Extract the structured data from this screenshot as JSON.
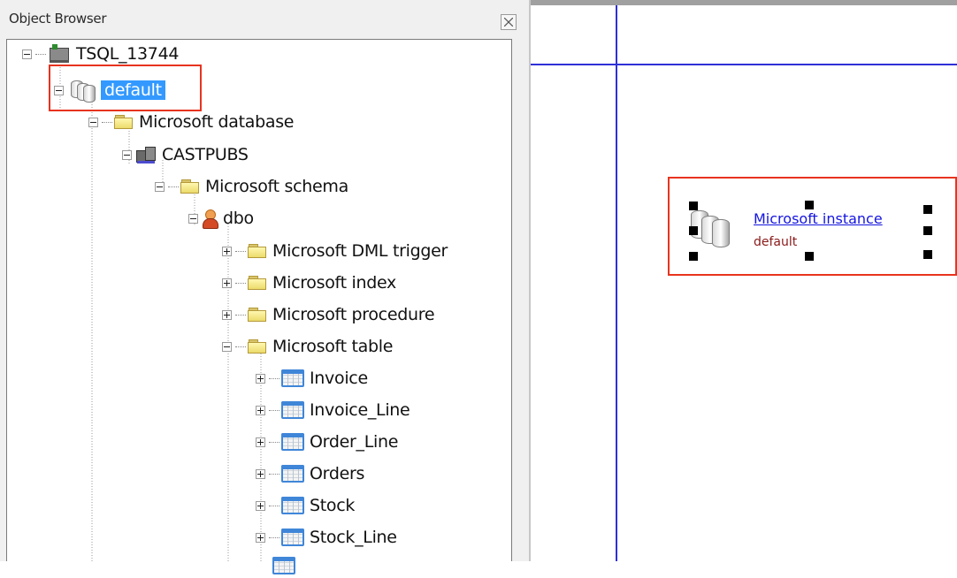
{
  "panel": {
    "title": "Object Browser"
  },
  "tree": {
    "root": "TSQL_13744",
    "instance": "default",
    "database_folder": "Microsoft database",
    "database": "CASTPUBS",
    "schema_folder": "Microsoft schema",
    "schema": "dbo",
    "folders": [
      "Microsoft DML trigger",
      "Microsoft index",
      "Microsoft procedure",
      "Microsoft table"
    ],
    "tables": [
      "Invoice",
      "Invoice_Line",
      "Order_Line",
      "Orders",
      "Stock",
      "Stock_Line"
    ]
  },
  "diagram": {
    "node_title": "Microsoft instance",
    "node_subtitle": "default"
  },
  "colors": {
    "selection": "#3399ff",
    "highlight_box": "#e8331f",
    "guide_lines": "#2f2fd8",
    "link": "#1515e0"
  }
}
